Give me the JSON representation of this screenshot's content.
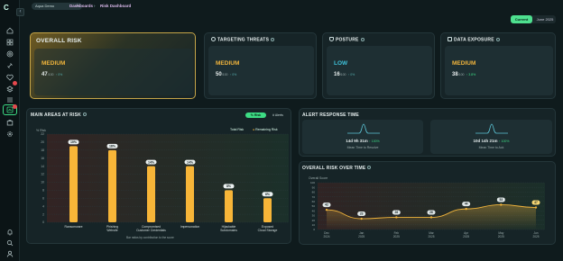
{
  "app": {
    "logo_text": "C",
    "collapse_glyph": "‹",
    "org_selector": "Aqua Demo",
    "breadcrumb": [
      "Dashboards",
      "Risk Dashboard"
    ],
    "breadcrumb_sep": "›"
  },
  "sidebar": {
    "icons": [
      "home-icon",
      "grid-icon",
      "target-icon",
      "link-icon",
      "heart-icon",
      "layers-icon",
      "list-icon",
      "risk-dashboard-icon",
      "bag-icon",
      "gear-icon"
    ],
    "bottom_icons": [
      "bell-icon",
      "search-icon",
      "user-icon"
    ],
    "active_item": "risk-dashboard-icon"
  },
  "period_toggle": {
    "current_label": "Current",
    "month_label": "June 2025",
    "selected": "Current"
  },
  "risk_cards": [
    {
      "title": "OVERALL RISK",
      "level": "MEDIUM",
      "score": "47",
      "denominator": "/100",
      "change": "↑ 0%",
      "level_color": "#f0b43c",
      "icon": "none"
    },
    {
      "title": "TARGETING THREATS",
      "level": "MEDIUM",
      "score": "50",
      "denominator": "/100",
      "change": "↑ 0%",
      "level_color": "#f0b43c",
      "icon": "target-icon"
    },
    {
      "title": "POSTURE",
      "level": "LOW",
      "score": "16",
      "denominator": "/100",
      "change": "↑ 0%",
      "level_color": "#3fc1d9",
      "icon": "shield-icon"
    },
    {
      "title": "DATA EXPOSURE",
      "level": "MEDIUM",
      "score": "38",
      "denominator": "/100",
      "change": "↑ 3.8%",
      "level_color": "#f0b43c",
      "icon": "database-icon"
    }
  ],
  "main_areas": {
    "title": "MAIN AREAS AT RISK",
    "toggle": [
      "% Risk",
      "# Alerts"
    ],
    "legend": [
      "Total Risk",
      "Remaining Risk"
    ],
    "footnote": "Bar ratios by contribution to the score"
  },
  "chart_data": [
    {
      "type": "bar",
      "title": "MAIN AREAS AT RISK",
      "ylabel": "% Risk",
      "ylim": [
        0,
        22
      ],
      "yticks": [
        0,
        2,
        4,
        6,
        8,
        10,
        12,
        14,
        16,
        18,
        20,
        22
      ],
      "categories": [
        "Ransomware",
        "Phishing Website",
        "Compromised Customer Credentials",
        "Impersonation",
        "Hijackable Subdomains",
        "Exposed Cloud Storage"
      ],
      "category_lines": [
        [
          "Ransomware"
        ],
        [
          "Phishing",
          "Website"
        ],
        [
          "Compromised",
          "Customer Credentials"
        ],
        [
          "Impersonation"
        ],
        [
          "Hijackable",
          "Subdomains"
        ],
        [
          "Exposed",
          "Cloud Storage"
        ]
      ],
      "values": [
        19,
        18,
        14,
        14,
        8,
        6
      ],
      "labels": [
        "19%",
        "18%",
        "14%",
        "14%",
        "8%",
        "6%"
      ],
      "series": [
        {
          "name": "Total Risk"
        },
        {
          "name": "Remaining Risk"
        }
      ],
      "bar_color": "#f7b538",
      "grid": true
    },
    {
      "type": "line",
      "title": "OVERALL RISK OVER TIME",
      "ylabel": "Overall Score",
      "ylim": [
        0,
        100
      ],
      "yticks": [
        0,
        10,
        20,
        30,
        40,
        50,
        60,
        70,
        80,
        90,
        100
      ],
      "categories": [
        "Dec 2024",
        "Jan 2025",
        "Feb 2025",
        "Mar 2025",
        "Apr 2025",
        "May 2025",
        "Jun 2025"
      ],
      "values": [
        42,
        23,
        26,
        26,
        44,
        53,
        47
      ],
      "line_color": "#f0b43c",
      "grid": true
    }
  ],
  "alert_response": {
    "title": "ALERT RESPONSE TIME",
    "items": [
      {
        "value": "14d 9h 31m",
        "change": "↑ 100%",
        "label": "Mean Time to Resolve"
      },
      {
        "value": "10d 14h 21m",
        "change": "↑ 100%",
        "label": "Mean Time to Ack"
      }
    ]
  },
  "risk_over_time": {
    "title": "OVERALL RISK OVER TIME"
  }
}
